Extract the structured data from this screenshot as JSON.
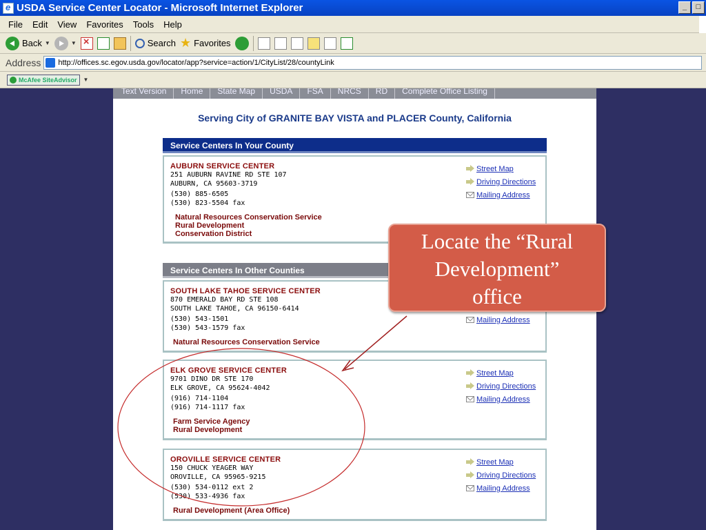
{
  "window": {
    "title": "USDA Service Center Locator - Microsoft Internet Explorer",
    "min": "_",
    "max": "□"
  },
  "menu": [
    "File",
    "Edit",
    "View",
    "Favorites",
    "Tools",
    "Help"
  ],
  "toolbar": {
    "back": "Back",
    "search": "Search",
    "favorites": "Favorites"
  },
  "address": {
    "label": "Address",
    "url": "http://offices.sc.egov.usda.gov/locator/app?service=action/1/CityList/28/countyLink"
  },
  "addon": {
    "label": "McAfee SiteAdvisor"
  },
  "nav": [
    "Text Version",
    "Home",
    "State Map",
    "USDA",
    "FSA",
    "NRCS",
    "RD",
    "Complete Office Listing"
  ],
  "heading": "Serving City of GRANITE BAY VISTA and PLACER County, California",
  "sections": {
    "your_county": "Service Centers In Your County",
    "other_counties": "Service Centers In Other Counties"
  },
  "links": {
    "street_map": "Street Map",
    "driving": "Driving Directions",
    "mailing": "Mailing Address"
  },
  "centers": [
    {
      "name": "AUBURN SERVICE CENTER",
      "address1": "251 AUBURN RAVINE RD STE 107",
      "address2": "AUBURN, CA 95603-3719",
      "phone": "(530) 885-6505",
      "fax": "(530) 823-5504 fax",
      "agencies": [
        "Natural Resources Conservation Service",
        "Rural Development",
        "Conservation District"
      ]
    },
    {
      "name": "SOUTH LAKE TAHOE SERVICE CENTER",
      "address1": "870 EMERALD BAY RD STE 108",
      "address2": "SOUTH LAKE TAHOE, CA 96150-6414",
      "phone": "(530) 543-1501",
      "fax": "(530) 543-1579 fax",
      "agencies": [
        "Natural Resources Conservation Service"
      ]
    },
    {
      "name": "ELK GROVE SERVICE CENTER",
      "address1": "9701 DINO DR STE 170",
      "address2": "ELK GROVE, CA 95624-4042",
      "phone": "(916) 714-1104",
      "fax": "(916) 714-1117 fax",
      "agencies": [
        "Farm Service Agency",
        "Rural Development"
      ]
    },
    {
      "name": "OROVILLE SERVICE CENTER",
      "address1": "150 CHUCK YEAGER WAY",
      "address2": "OROVILLE, CA 95965-9215",
      "phone": "(530) 534-0112 ext 2",
      "fax": "(530) 533-4936 fax",
      "agencies": [
        "Rural Development (Area Office)"
      ]
    }
  ],
  "callout": {
    "line1": "Locate the “Rural",
    "line2": "Development”",
    "line3": "office"
  }
}
